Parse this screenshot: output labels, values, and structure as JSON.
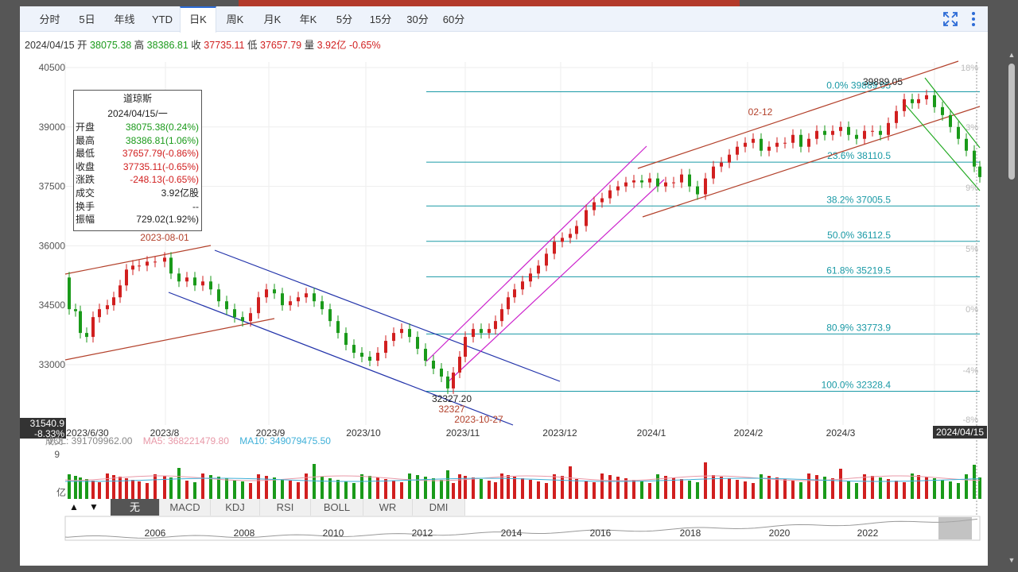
{
  "tabs": [
    "分时",
    "5日",
    "年线",
    "YTD",
    "日K",
    "周K",
    "月K",
    "年K",
    "5分",
    "15分",
    "30分",
    "60分"
  ],
  "active_tab": "日K",
  "ohlc_bar": {
    "date": "2024/04/15",
    "open_label": "开",
    "open": "38075.38",
    "high_label": "高",
    "high": "38386.81",
    "close_label": "收",
    "close": "37735.11",
    "low_label": "低",
    "low": "37657.79",
    "vol_label": "量",
    "vol": "3.92亿",
    "pct": "-0.65%"
  },
  "infobox": {
    "name": "道琼斯",
    "date": "2024/04/15/一",
    "rows": [
      {
        "k": "开盘",
        "v": "38075.38(0.24%)",
        "c": "gr"
      },
      {
        "k": "最高",
        "v": "38386.81(1.06%)",
        "c": "gr"
      },
      {
        "k": "最低",
        "v": "37657.79(-0.86%)",
        "c": "rd"
      },
      {
        "k": "收盘",
        "v": "37735.11(-0.65%)",
        "c": "rd"
      },
      {
        "k": "涨跌",
        "v": "-248.13(-0.65%)",
        "c": "rd"
      },
      {
        "k": "成交",
        "v": "3.92亿股",
        "c": ""
      },
      {
        "k": "换手",
        "v": "--",
        "c": ""
      },
      {
        "k": "振幅",
        "v": "729.02(1.92%)",
        "c": ""
      }
    ]
  },
  "volume_legend": {
    "vol": "VOL: 391709962.00",
    "ma5": "MA5: 368221479.80",
    "ma10": "MA10: 349079475.50",
    "prefix": "成交",
    "axis_top": "9",
    "axis_unit": "亿"
  },
  "indicator_tabs": [
    "无",
    "MACD",
    "KDJ",
    "RSI",
    "BOLL",
    "WR",
    "DMI"
  ],
  "active_indicator": "无",
  "indicator_arrows": [
    "▲",
    "▼"
  ],
  "colors": {
    "up": "#d11f1f",
    "down": "#1a9a1a",
    "fib": "#1a9aa6",
    "channel_red": "#b3412b",
    "channel_blue": "#2233aa",
    "channel_magenta": "#cc22cc",
    "channel_green": "#22aa22",
    "ma5": "#e899a8",
    "ma10": "#3fb0d8"
  },
  "chart_data": {
    "type": "candlestick",
    "title": "道琼斯",
    "y_ticks": [
      40500,
      39000,
      37500,
      36000,
      34500,
      33000
    ],
    "ylim": [
      31540.9,
      40900
    ],
    "pct_ticks": [
      "18%",
      "9%",
      "3%",
      "0%",
      "5%",
      "0%",
      "-4%",
      "-8%"
    ],
    "x_ticks": [
      "2023/6/30",
      "2023/8",
      "2023/9",
      "2023/10",
      "2023/11",
      "2023/12",
      "2024/1",
      "2024/2",
      "2024/3"
    ],
    "crosshair_x_label": "2024/04/15",
    "crosshair_y_label": "31540.9",
    "crosshair_y_pct": "-8.33%",
    "fib_levels": [
      {
        "label": "0.0% 39889.05",
        "value": 39889.05
      },
      {
        "label": "23.6% 38110.5",
        "value": 38110.5
      },
      {
        "label": "38.2% 37005.5",
        "value": 37005.5
      },
      {
        "label": "50.0% 36112.5",
        "value": 36112.5
      },
      {
        "label": "61.8% 35219.5",
        "value": 35219.5
      },
      {
        "label": "80.9% 33773.9",
        "value": 33773.9
      },
      {
        "label": "100.0% 32328.4",
        "value": 32328.4
      }
    ],
    "annotations": [
      {
        "text": "2023-08-01"
      },
      {
        "text": "32327.20"
      },
      {
        "text": "32327"
      },
      {
        "text": "2023-10-27"
      },
      {
        "text": "02-12"
      },
      {
        "text": "39889.05"
      }
    ],
    "overview_years": [
      "2006",
      "2008",
      "2010",
      "2012",
      "2014",
      "2016",
      "2018",
      "2020",
      "2022"
    ]
  }
}
